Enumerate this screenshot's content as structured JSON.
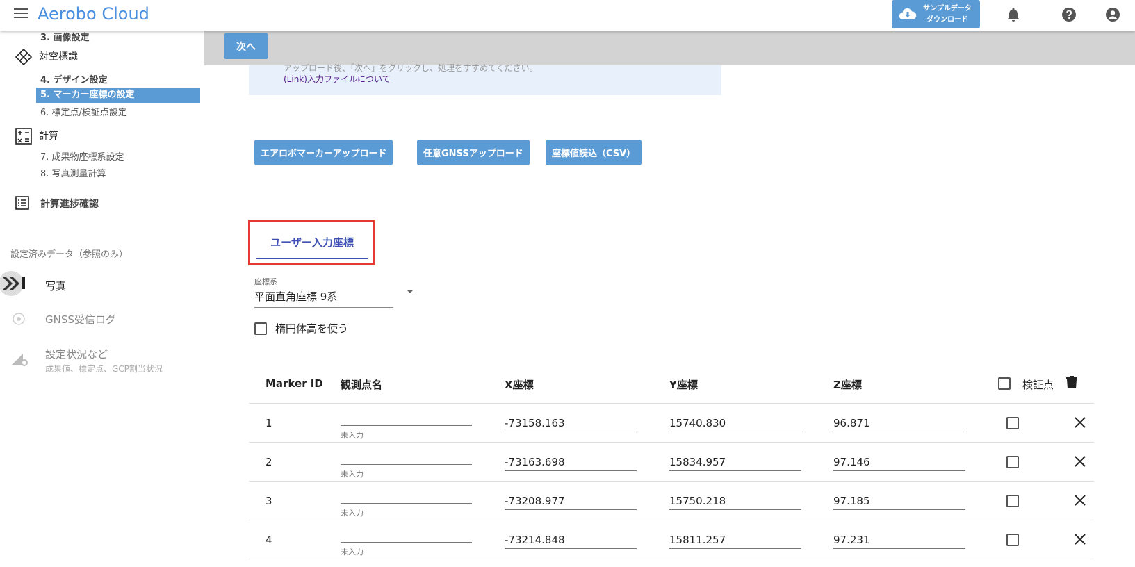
{
  "app": {
    "title": "Aerobo Cloud",
    "sample_download": [
      "サンプルデータ",
      "ダウンロード"
    ]
  },
  "sidebar": {
    "steps": {
      "s3": "3. 画像設定",
      "s4": "4. デザイン設定",
      "s5": "5. マーカー座標の設定",
      "s6": "6. 標定点/検証点設定",
      "s7": "7. 成果物座標系設定",
      "s8": "8. 写真測量計算"
    },
    "sections": {
      "marker": "対空標識",
      "calc": "計算",
      "progress": "計算進捗確認"
    },
    "reference": {
      "title": "設定済みデータ（参照のみ）",
      "photo": "写真",
      "gnss": "GNSS受信ログ",
      "status": "設定状況など",
      "status_sub": "成果値、標定点、GCP割当状況"
    }
  },
  "toolbar": {
    "next_label": "次へ"
  },
  "info": {
    "text": "アップロード後、「次へ」をクリックし、処理をすすめてください。",
    "link": "(Link)入力ファイルについて"
  },
  "uploads": {
    "aerobo": "エアロボマーカーアップロード",
    "gnss": "任意GNSSアップロード",
    "csv": "座標値読込（CSV）"
  },
  "tab": {
    "label": "ユーザー入力座標"
  },
  "coord_system": {
    "label": "座標系",
    "value": "平面直角座標 9系"
  },
  "ellipsoid": {
    "label": "楕円体高を使う",
    "checked": false
  },
  "table": {
    "headers": {
      "id": "Marker ID",
      "name": "観測点名",
      "x": "X座標",
      "y": "Y座標",
      "z": "Z座標",
      "verify": "検証点"
    },
    "name_placeholder": "未入力",
    "rows": [
      {
        "id": "1",
        "name": "",
        "x": "-73158.163",
        "y": "15740.830",
        "z": "96.871",
        "verify": false
      },
      {
        "id": "2",
        "name": "",
        "x": "-73163.698",
        "y": "15834.957",
        "z": "97.146",
        "verify": false
      },
      {
        "id": "3",
        "name": "",
        "x": "-73208.977",
        "y": "15750.218",
        "z": "97.185",
        "verify": false
      },
      {
        "id": "4",
        "name": "",
        "x": "-73214.848",
        "y": "15811.257",
        "z": "97.231",
        "verify": false
      }
    ]
  },
  "colors": {
    "accent": "#5b9bd5",
    "brand": "#4a90e2",
    "tab": "#3f51b5",
    "highlight": "#e53935"
  }
}
